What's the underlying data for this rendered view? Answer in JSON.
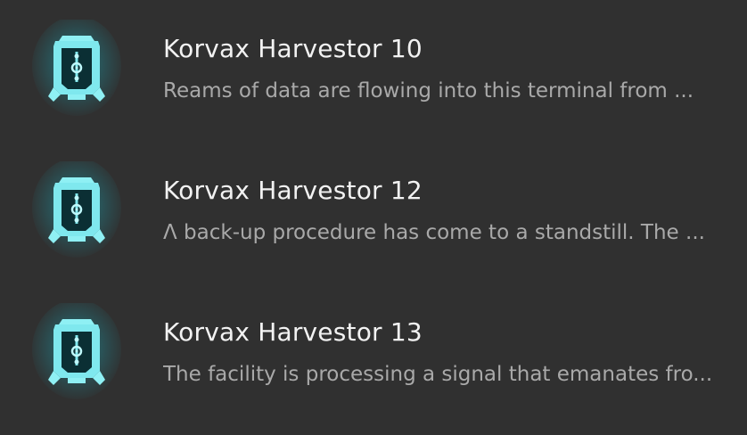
{
  "entries": [
    {
      "icon": "korvax-harvestor-terminal-icon",
      "title": "Korvax Harvestor 10",
      "description": "Reams of data are flowing into this terminal from ..."
    },
    {
      "icon": "korvax-harvestor-terminal-icon",
      "title": "Korvax Harvestor 12",
      "description": "Λ back-up procedure has come to a standstill. The ..."
    },
    {
      "icon": "korvax-harvestor-terminal-icon",
      "title": "Korvax Harvestor 13",
      "description": "The facility is processing a signal that emanates fro..."
    }
  ],
  "colors": {
    "background": "#303030",
    "icon_glow": "#22d3e0",
    "title_text": "#f2f2f2",
    "description_text": "#a9a9a9"
  }
}
